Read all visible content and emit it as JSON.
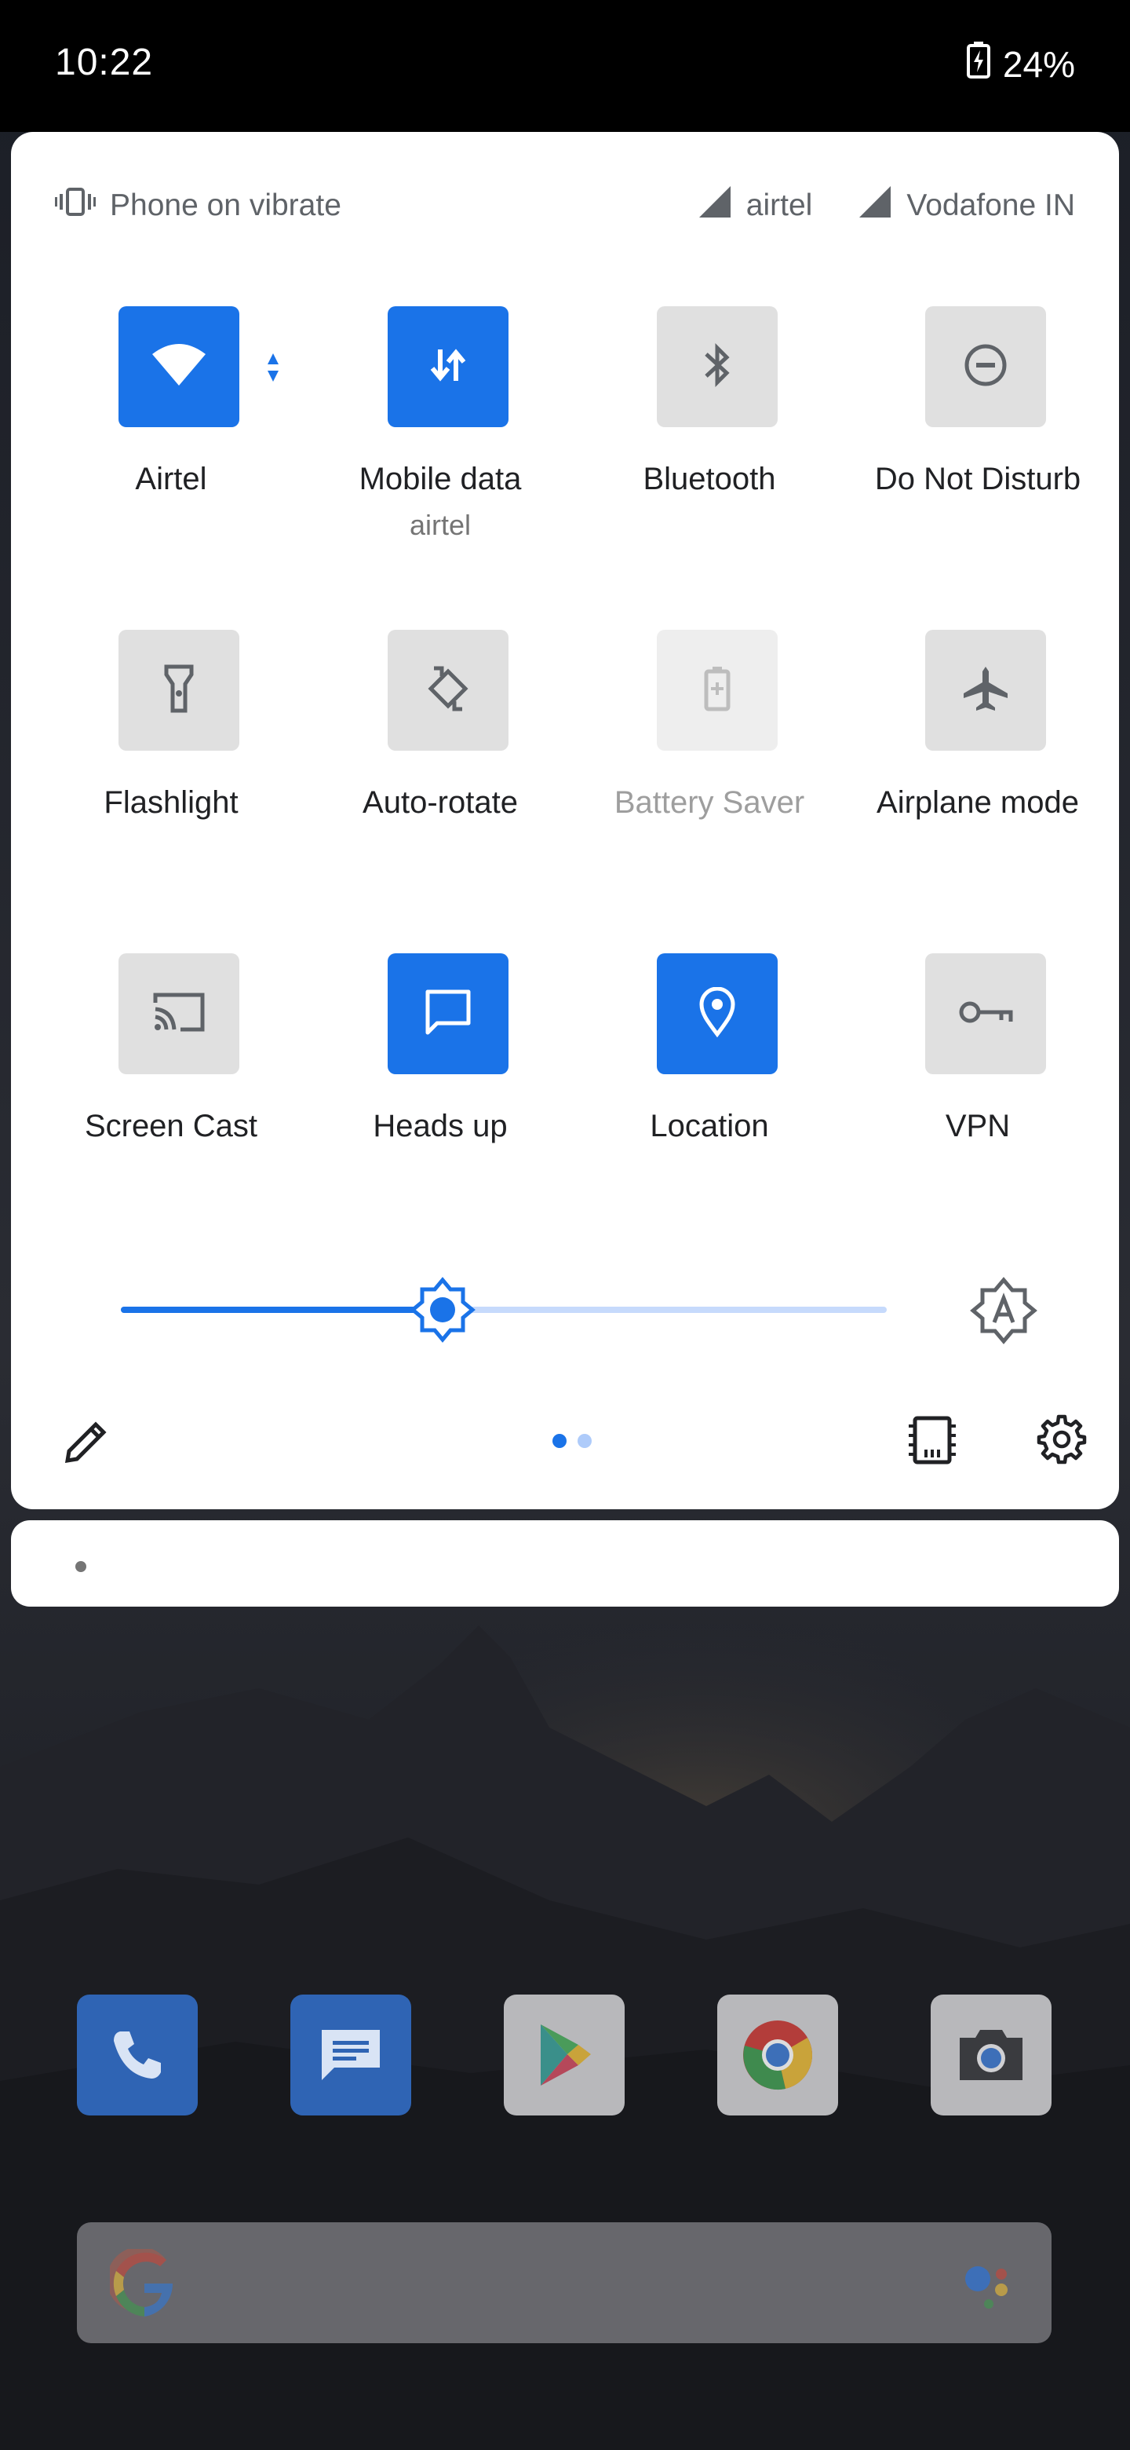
{
  "status_bar": {
    "time": "10:22",
    "battery": "24%"
  },
  "quick_settings": {
    "ringer_status": "Phone on vibrate",
    "carriers": [
      "airtel",
      "Vodafone IN"
    ],
    "tiles": [
      {
        "label": "Airtel",
        "icon": "wifi-icon",
        "state": "on"
      },
      {
        "label": "Mobile data",
        "sublabel": "airtel",
        "icon": "mobile-data-icon",
        "state": "on"
      },
      {
        "label": "Bluetooth",
        "icon": "bluetooth-icon",
        "state": "off"
      },
      {
        "label": "Do Not Disturb",
        "icon": "do-not-disturb-icon",
        "state": "off"
      },
      {
        "label": "Flashlight",
        "icon": "flashlight-icon",
        "state": "off"
      },
      {
        "label": "Auto-rotate",
        "icon": "auto-rotate-icon",
        "state": "off"
      },
      {
        "label": "Battery Saver",
        "icon": "battery-saver-icon",
        "state": "unavailable"
      },
      {
        "label": "Airplane mode",
        "icon": "airplane-icon",
        "state": "off"
      },
      {
        "label": "Screen Cast",
        "icon": "cast-icon",
        "state": "off"
      },
      {
        "label": "Heads up",
        "icon": "heads-up-icon",
        "state": "on"
      },
      {
        "label": "Location",
        "icon": "location-icon",
        "state": "on"
      },
      {
        "label": "VPN",
        "icon": "vpn-key-icon",
        "state": "off"
      }
    ],
    "brightness_fraction": 0.42,
    "pages": 2,
    "current_page": 1
  },
  "dock": {
    "apps": [
      "phone-app-icon",
      "messages-app-icon",
      "play-store-app-icon",
      "chrome-app-icon",
      "camera-app-icon"
    ]
  },
  "colors": {
    "accent": "#1a73e8",
    "tile_off": "#e0e0e0",
    "panel": "#ffffff"
  }
}
